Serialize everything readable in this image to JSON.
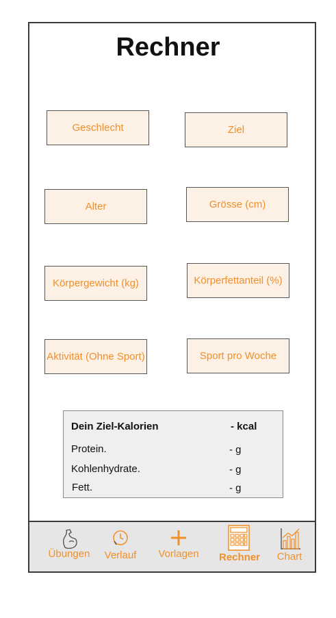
{
  "title": "Rechner",
  "fields": {
    "geschlecht": "Geschlecht",
    "ziel": "Ziel",
    "alter": "Alter",
    "groesse": "Grösse (cm)",
    "gewicht": "Körpergewicht (kg)",
    "fettanteil": "Körperfettanteil (%)",
    "aktivitaet": "Aktivität (Ohne Sport)",
    "sport": "Sport pro Woche"
  },
  "summary": {
    "kalorien_label": "Dein Ziel-Kalorien",
    "kalorien_value": "- kcal",
    "protein_label": "Protein.",
    "protein_value": "- g",
    "kohlenhydrate_label": "Kohlenhydrate.",
    "kohlenhydrate_value": "- g",
    "fett_label": "Fett.",
    "fett_value": "- g"
  },
  "tabs": [
    {
      "label": "Übungen",
      "icon": "flexed-arm-icon"
    },
    {
      "label": "Verlauf",
      "icon": "clock-icon"
    },
    {
      "label": "Vorlagen",
      "icon": "plus-icon"
    },
    {
      "label": "Rechner",
      "icon": "calculator-icon",
      "active": true
    },
    {
      "label": "Chart",
      "icon": "bar-chart-icon"
    }
  ],
  "colors": {
    "accent": "#f0902a",
    "field_bg": "#fdf0e4",
    "summary_bg": "#efefef",
    "tabbar_bg": "#e6e6e6"
  }
}
